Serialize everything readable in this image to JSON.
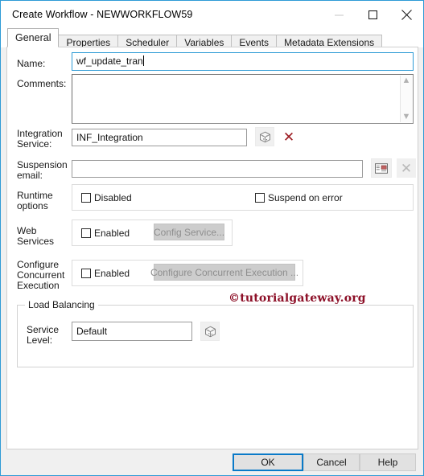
{
  "window": {
    "title": "Create Workflow - NEWWORKFLOW59",
    "controls": {
      "minimize": "minimize-icon",
      "maximize": "maximize-icon",
      "close": "close-icon"
    }
  },
  "tabs": [
    {
      "label": "General",
      "active": true
    },
    {
      "label": "Properties",
      "active": false
    },
    {
      "label": "Scheduler",
      "active": false
    },
    {
      "label": "Variables",
      "active": false
    },
    {
      "label": "Events",
      "active": false
    },
    {
      "label": "Metadata Extensions",
      "active": false
    }
  ],
  "form": {
    "name": {
      "label": "Name:",
      "value": "wf_update_tran",
      "placeholder": ""
    },
    "comments": {
      "label": "Comments:",
      "value": "",
      "placeholder": ""
    },
    "integration_service": {
      "label_line1": "Integration",
      "label_line2": "Service:",
      "value": "INF_Integration",
      "browse_icon": "cube-icon",
      "clear_icon": "red-x-icon"
    },
    "suspension_email": {
      "label_line1": "Suspension",
      "label_line2": "email:",
      "value": "",
      "select_icon": "email-card-icon",
      "clear_icon": "grey-x-icon"
    },
    "runtime_options": {
      "label_line1": "Runtime",
      "label_line2": "options",
      "disabled": {
        "label": "Disabled",
        "checked": false
      },
      "suspend_on_error": {
        "label": "Suspend on error",
        "checked": false
      }
    },
    "web_services": {
      "label_line1": "Web",
      "label_line2": "Services",
      "enabled": {
        "label": "Enabled",
        "checked": false
      },
      "config_button": {
        "label": "Config Service...",
        "disabled": true
      }
    },
    "concurrent_execution": {
      "label_line1": "Configure",
      "label_line2": "Concurrent",
      "label_line3": "Execution",
      "enabled": {
        "label": "Enabled",
        "checked": false
      },
      "config_button": {
        "label": "Configure Concurrent Execution ...",
        "disabled": true
      }
    },
    "load_balancing": {
      "legend": "Load Balancing",
      "service_level": {
        "label_line1": "Service",
        "label_line2": "Level:",
        "value": "Default",
        "browse_icon": "cube-icon"
      }
    }
  },
  "watermark": {
    "text": "©tutorialgateway.org",
    "color": "#8d1028"
  },
  "footer": {
    "ok": "OK",
    "cancel": "Cancel",
    "help": "Help"
  }
}
